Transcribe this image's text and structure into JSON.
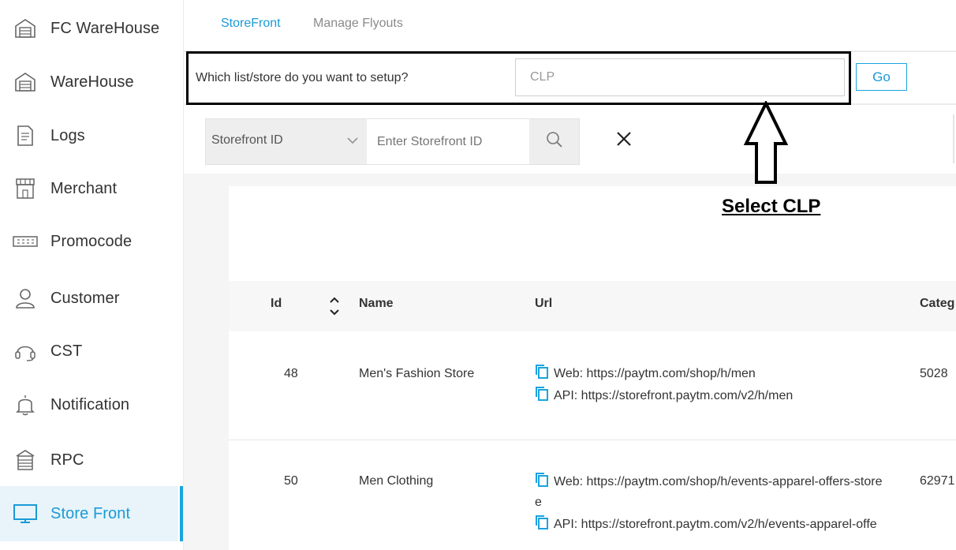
{
  "sidebar": {
    "items": [
      {
        "label": "FC WareHouse",
        "icon": "warehouse-icon"
      },
      {
        "label": "WareHouse",
        "icon": "warehouse-icon"
      },
      {
        "label": "Logs",
        "icon": "document-icon"
      },
      {
        "label": "Merchant",
        "icon": "store-icon"
      },
      {
        "label": "Promocode",
        "icon": "ticket-icon"
      },
      {
        "label": "Customer",
        "icon": "user-icon"
      },
      {
        "label": "CST",
        "icon": "headset-icon"
      },
      {
        "label": "Notification",
        "icon": "bell-icon"
      },
      {
        "label": "RPC",
        "icon": "building-icon"
      },
      {
        "label": "Store Front",
        "icon": "monitor-icon",
        "active": true
      }
    ]
  },
  "tabs": {
    "storefront": "StoreFront",
    "flyouts": "Manage Flyouts"
  },
  "setup": {
    "question": "Which list/store do you want to setup?",
    "value": "CLP",
    "go_label": "Go"
  },
  "search": {
    "select_value": "Storefront ID",
    "placeholder": "Enter Storefront ID"
  },
  "annotation": {
    "text": "Select CLP"
  },
  "table": {
    "headers": {
      "id": "Id",
      "name": "Name",
      "url": "Url",
      "category": "Categ"
    },
    "rows": [
      {
        "id": "48",
        "name": "Men's Fashion Store",
        "web": "Web: https://paytm.com/shop/h/men",
        "api": "API: https://storefront.paytm.com/v2/h/men",
        "category": "5028"
      },
      {
        "id": "50",
        "name": "Men Clothing",
        "web": "Web: https://paytm.com/shop/h/events-apparel-offers-store",
        "web_wrap": "e",
        "api": "API: https://storefront.paytm.com/v2/h/events-apparel-offe",
        "category": "62971"
      }
    ]
  },
  "colors": {
    "accent": "#1a9ad6",
    "active_bg": "#e8f4fa"
  }
}
